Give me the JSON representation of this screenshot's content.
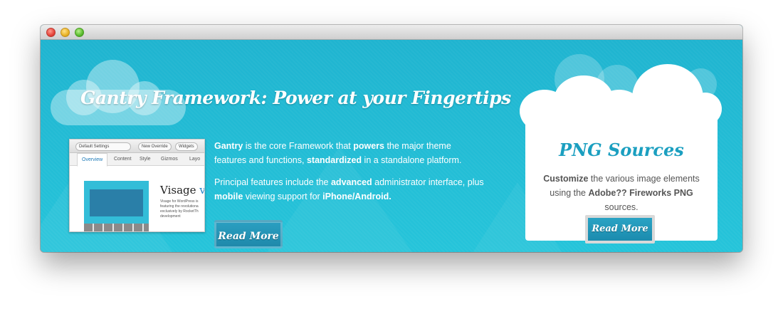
{
  "window": {
    "controls": [
      "close",
      "minimize",
      "maximize"
    ],
    "colors": {
      "close": "#e5433a",
      "minimize": "#e9b225",
      "maximize": "#5bbd2f"
    }
  },
  "hero": {
    "background_color": "#22bdd6",
    "title": "Gantry Framework: Power at your Fingertips",
    "thumbnail": {
      "toolbar": {
        "settings": "Default Settings",
        "override": "New Override",
        "widgets": "Widgets"
      },
      "tabs": [
        "Overview",
        "Content",
        "Style",
        "Gizmos",
        "Layo"
      ],
      "site_heading": "Visage ",
      "site_heading_accent": "v",
      "site_text": "Visage for WordPress is featuring the revolutiona exclusively by RocketTh development"
    },
    "description": {
      "p1": [
        {
          "text": "Gantry",
          "bold": true
        },
        {
          "text": " is the core Framework that ",
          "bold": false
        },
        {
          "text": "powers",
          "bold": true
        },
        {
          "text": " the major theme features and functions, ",
          "bold": false
        },
        {
          "text": "standardized",
          "bold": true
        },
        {
          "text": " in a standalone platform.",
          "bold": false
        }
      ],
      "p2": [
        {
          "text": "Principal features include the ",
          "bold": false
        },
        {
          "text": "advanced",
          "bold": true
        },
        {
          "text": " administrator interface, plus ",
          "bold": false
        },
        {
          "text": "mobile",
          "bold": true
        },
        {
          "text": " viewing support for ",
          "bold": false
        },
        {
          "text": "iPhone/Android.",
          "bold": true
        }
      ]
    },
    "read_more_label": "Read More"
  },
  "panel": {
    "title": "PNG Sources",
    "text": [
      {
        "text": "Customize",
        "bold": true
      },
      {
        "text": " the various image elements using the ",
        "bold": false
      },
      {
        "text": "Adobe?? Fireworks PNG",
        "bold": true
      },
      {
        "text": " sources.",
        "bold": false
      }
    ],
    "read_more_label": "Read More",
    "accent_color": "#1b9fc0"
  }
}
